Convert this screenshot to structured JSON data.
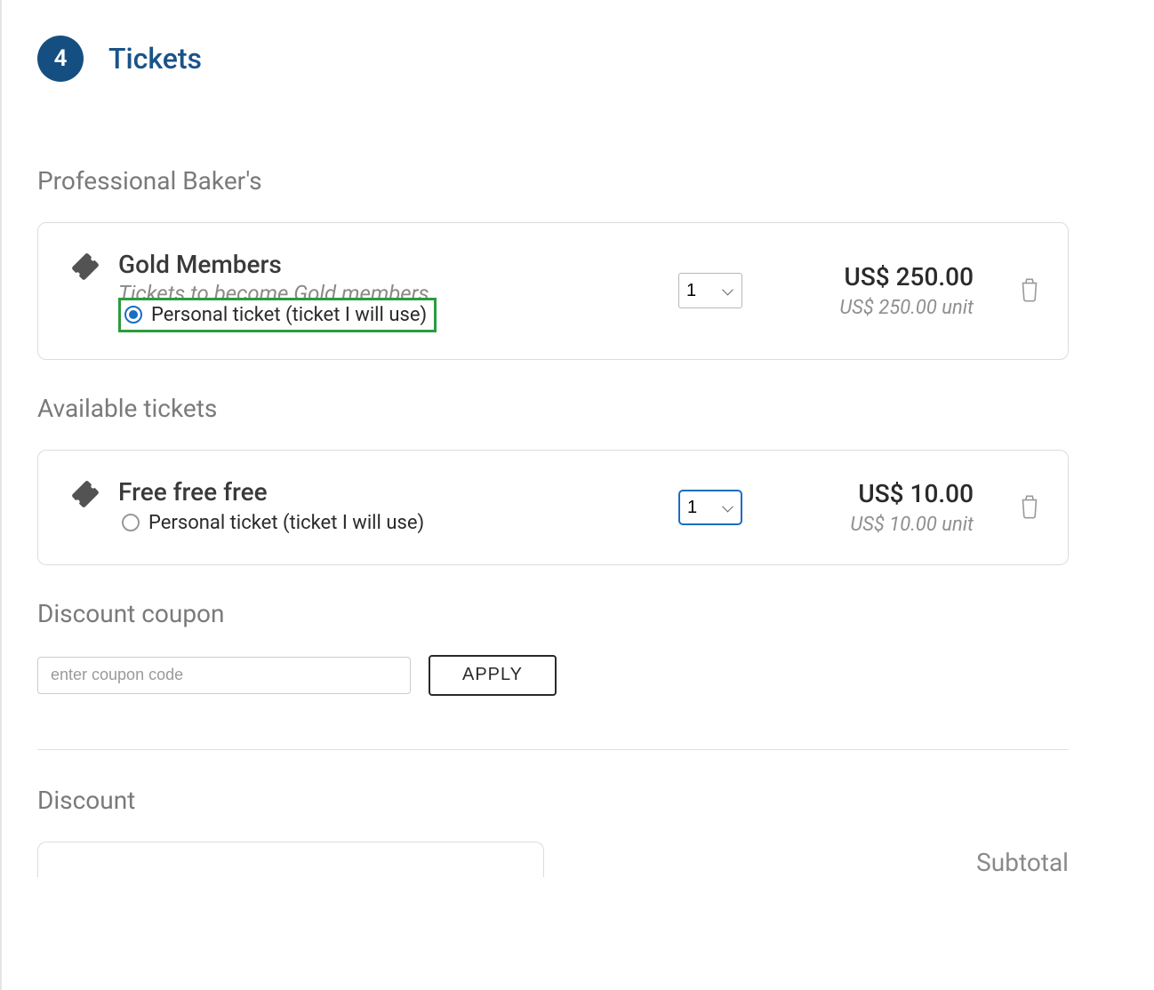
{
  "step": {
    "number": "4",
    "title": "Tickets"
  },
  "sections": {
    "professional": "Professional Baker's",
    "available": "Available tickets",
    "discount_coupon": "Discount coupon",
    "discount": "Discount",
    "subtotal": "Subtotal"
  },
  "tickets": {
    "gold": {
      "name": "Gold Members",
      "description": "Tickets to become Gold members",
      "personal_label": "Personal ticket (ticket I will use)",
      "personal_selected": true,
      "quantity": "1",
      "price_total": "US$ 250.00",
      "price_unit": "US$ 250.00 unit"
    },
    "free": {
      "name": "Free free free",
      "personal_label": "Personal ticket (ticket I will use)",
      "personal_selected": false,
      "quantity": "1",
      "price_total": "US$ 10.00",
      "price_unit": "US$ 10.00 unit"
    }
  },
  "coupon": {
    "placeholder": "enter coupon code",
    "apply": "APPLY"
  }
}
